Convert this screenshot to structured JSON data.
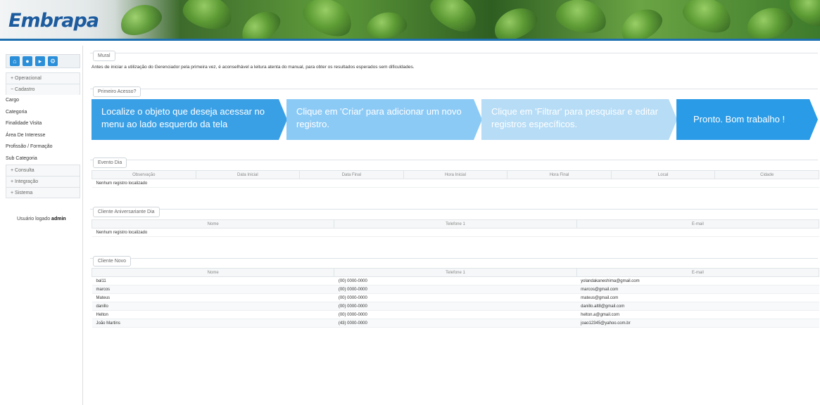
{
  "header": {
    "logo": "Embrapa"
  },
  "sidebar": {
    "icons": [
      "home-icon",
      "user-icon",
      "flag-icon",
      "settings-icon"
    ],
    "menu": {
      "operacional": "+ Operacional",
      "cadastro": "− Cadastro",
      "items": [
        "Cargo",
        "Categoria",
        "Finalidade Visita",
        "Área De Interesse",
        "Profissão / Formação",
        "Sub Categoria"
      ],
      "consulta": "+ Consulta",
      "integracao": "+ Integração",
      "sistema": "+ Sistema"
    },
    "logged_label": "Usuário logado",
    "logged_user": "admin"
  },
  "mural": {
    "legend": "Mural",
    "text": "Antes de iniciar a utilização do Gerenciador pela primeira vez, é aconselhável a leitura atenta do manual, para obter os resultados esperados sem dificuldades."
  },
  "primeiro_acesso": {
    "legend": "Primeiro Acesso?",
    "steps": [
      {
        "text": "Localize o objeto que deseja acessar no menu ao lado esquerdo da tela",
        "color": "#3aa0e6"
      },
      {
        "text": "Clique em 'Criar' para adicionar um novo registro.",
        "color": "#8ccaf6"
      },
      {
        "text": "Clique em 'Filtrar' para pesquisar e editar registros específicos.",
        "color": "#b6dcf6"
      },
      {
        "text": "Pronto. Bom trabalho !",
        "color": "#2a9be6"
      }
    ]
  },
  "evento_dia": {
    "legend": "Evento Dia",
    "columns": [
      "Observação",
      "Data Inicial",
      "Data Final",
      "Hora Inicial",
      "Hora Final",
      "Local",
      "Cidade"
    ],
    "empty": "Nenhum registro localizado"
  },
  "aniversariante": {
    "legend": "Cliente Aniversariante Dia",
    "columns": [
      "Nome",
      "Telefone 1",
      "E-mail"
    ],
    "empty": "Nenhum registro localizado"
  },
  "cliente_novo": {
    "legend": "Cliente Novo",
    "columns": [
      "Nome",
      "Telefone 1",
      "E-mail"
    ],
    "rows": [
      [
        "bal11",
        "(00) 0000-0000",
        "yolandakaneshima@gmail.com"
      ],
      [
        "marcos",
        "(00) 0000-0000",
        "marcos@gmail.com"
      ],
      [
        "Mateus",
        "(00) 0000-0000",
        "mateus@gmail.com"
      ],
      [
        "danillo",
        "(00) 0000-0000",
        "danillo.alt8@gmail.com"
      ],
      [
        "Helton",
        "(00) 0000-0000",
        "helton.a@gmail.com"
      ],
      [
        "João Martins",
        "(43) 0000-0000",
        "joao12345@yahoo.com.br"
      ]
    ]
  }
}
